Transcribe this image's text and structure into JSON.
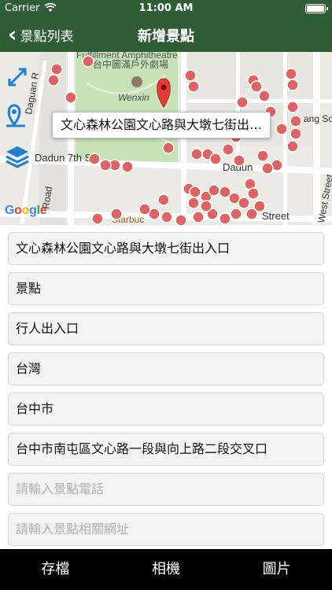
{
  "status_bar": {
    "carrier": "Carrier",
    "time": "11:00 AM"
  },
  "nav": {
    "back_label": "景點列表",
    "title": "新增景點"
  },
  "map": {
    "callout": "文心森林公園文心路與大墩七街出…",
    "street_labels": {
      "dadun": "Dadun 7th S",
      "wenxin": "Wenxin",
      "dadun_right": "Dadun",
      "street": "Street",
      "west_street": "West Street",
      "ang_so": "ang So",
      "daguan": "Daguan R",
      "park_name": "台中圖滿戶外劇場",
      "amphi": "Fulfillment Amphitheatre",
      "road": "Road",
      "starbucks": "Starbuc"
    },
    "google_logo": "Google"
  },
  "form": {
    "fields": [
      {
        "value": "文心森林公園文心路與大墩七街出入口",
        "placeholder": ""
      },
      {
        "value": "景點",
        "placeholder": ""
      },
      {
        "value": "行人出入口",
        "placeholder": ""
      },
      {
        "value": "台灣",
        "placeholder": ""
      },
      {
        "value": "台中市",
        "placeholder": ""
      },
      {
        "value": "台中市南屯區文心路一段與向上路二段交叉口",
        "placeholder": ""
      },
      {
        "value": "",
        "placeholder": "請輸入景點電話"
      },
      {
        "value": "",
        "placeholder": "請輸入景點相關網址"
      }
    ]
  },
  "toolbar": {
    "save": "存檔",
    "camera": "相機",
    "photos": "圖片"
  },
  "colors": {
    "nav_green": "#2f5d36",
    "map_pin": "#e06363",
    "selected_pin": "#e53935",
    "ctrl_blue": "#1f7fd6",
    "toolbar_bg": "#000000"
  }
}
